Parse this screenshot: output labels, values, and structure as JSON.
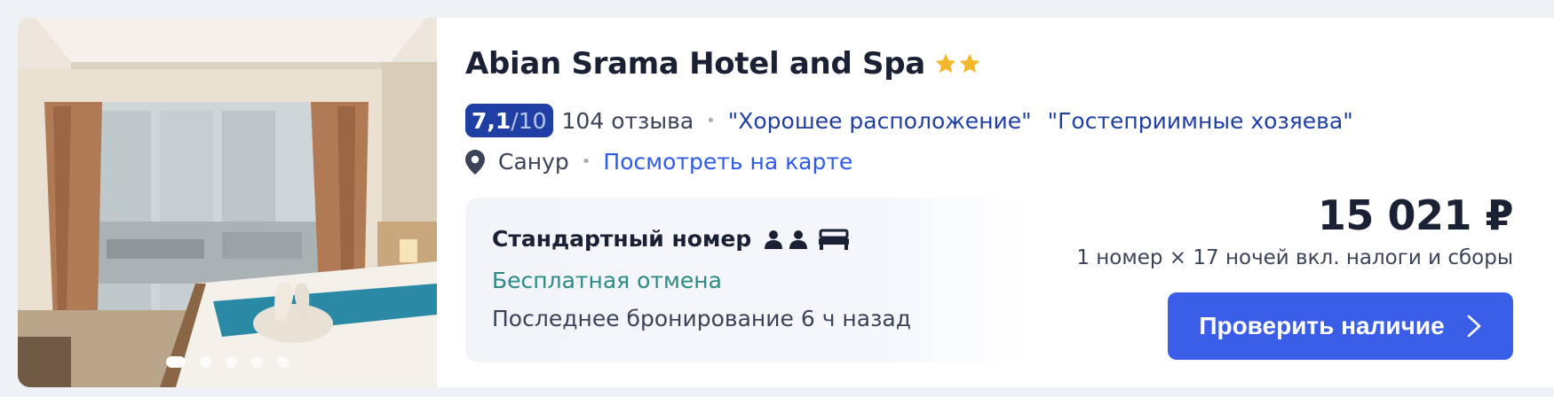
{
  "hotel": {
    "name": "Abian Srama Hotel and Spa",
    "star_count": 2,
    "star_color": "#f5b72a"
  },
  "rating": {
    "score": "7,1",
    "out_of": "/10",
    "reviews": "104 отзыва",
    "tags": [
      "\"Хорошее расположение\"",
      "\"Гостеприимные хозяева\""
    ]
  },
  "location": {
    "city": "Санур",
    "map_link": "Посмотреть на карте"
  },
  "room": {
    "name": "Стандартный номер",
    "guests": 2,
    "cancellation": "Бесплатная отмена",
    "last_booking": "Последнее бронирование 6 ч назад"
  },
  "price": {
    "amount": "15 021 ₽",
    "note": "1 номер × 17 ночей вкл. налоги и сборы"
  },
  "cta": {
    "label": "Проверить наличие"
  },
  "gallery": {
    "photo_count": 5,
    "active_index": 0
  },
  "colors": {
    "accent": "#3a5ee8",
    "score_badge": "#1f3fa5",
    "cancel_text": "#2c8a84"
  },
  "icons": {
    "location": "map-pin-icon",
    "guest": "person-icon",
    "bed": "bed-icon",
    "cta_arrow": "chevron-right-icon"
  }
}
